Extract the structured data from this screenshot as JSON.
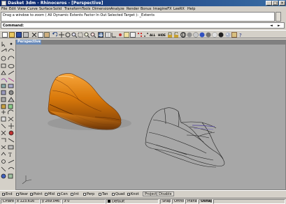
{
  "window": {
    "title": "Dasket 3dm - Rhinoceros - [Perspective]"
  },
  "menu": {
    "items": [
      "File",
      "Edit",
      "View",
      "Curve",
      "Surface",
      "Solid",
      "Transform",
      "Tools",
      "Dimension",
      "Analyze",
      "Render",
      "Bonus",
      "ImagineFX",
      "LeeRX",
      "Help"
    ]
  },
  "command_history": {
    "line1": "Drag a window to zoom ( All  Dynamic  Extents  Factor  In  Out  Selected  Target ): _Extents",
    "line2": ""
  },
  "command_prompt": {
    "label": "Command:"
  },
  "toolbar": {
    "buttons": [
      "new-icon",
      "open-icon",
      "save-icon",
      "print-icon",
      "cut-icon",
      "copy-icon",
      "paste-icon",
      "undo-icon",
      "pan-icon",
      "rotate-icon",
      "zoom-icon",
      "zoom-window-icon",
      "zoom-extents-icon",
      "zoom-selected-icon",
      "four-views-icon",
      "grid-icon",
      "ortho-icon",
      "osnap-icon",
      "layer-icon",
      "properties-icon",
      "points-on-icon",
      "points-off-icon",
      "hide-icon",
      "show-icon",
      "lock-icon",
      "unlock-icon",
      "wireframe-icon",
      "shaded-icon",
      "render-icon",
      "sphere-blue-icon",
      "sphere-gray-icon",
      "sphere-light-icon",
      "sphere-dark-icon",
      "render-preview-icon",
      "settings-icon",
      "help-icon"
    ],
    "text_all": "ALL",
    "text_hide": "HIDE"
  },
  "viewport": {
    "tab_label": "Perspective",
    "background": "#a7a7a7",
    "accent": "#e8860c"
  },
  "osnap": {
    "items": [
      {
        "label": "End",
        "checked": true
      },
      {
        "label": "Near",
        "checked": false
      },
      {
        "label": "Point",
        "checked": true
      },
      {
        "label": "Mid",
        "checked": false
      },
      {
        "label": "Cen",
        "checked": false
      },
      {
        "label": "Int",
        "checked": false
      },
      {
        "label": "Perp",
        "checked": false
      },
      {
        "label": "Tan",
        "checked": false
      },
      {
        "label": "Quad",
        "checked": false
      },
      {
        "label": "Knot",
        "checked": true
      }
    ],
    "project_label": "Project",
    "disable_label": "Disable"
  },
  "status": {
    "cplane": "CPlane",
    "x": "x 123.616",
    "y": "y 269.046",
    "z": "z 0",
    "layer": "Default",
    "snap": "Snap",
    "ortho": "Ortho",
    "planar": "Planar",
    "osnap": "Osnap"
  }
}
